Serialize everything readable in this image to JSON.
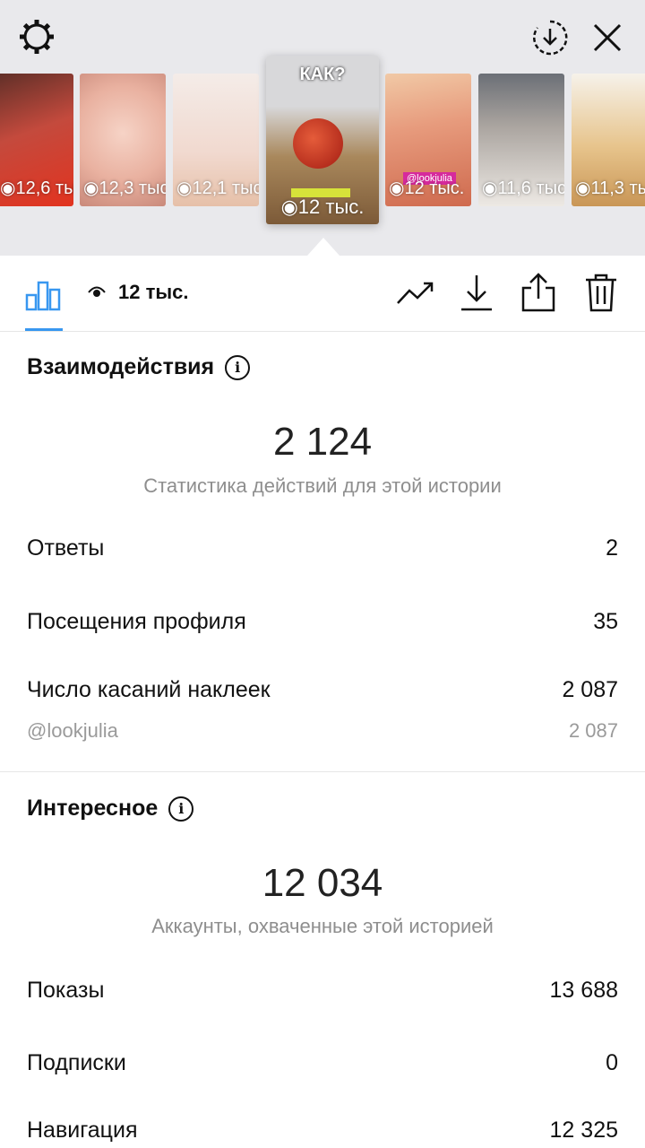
{
  "top": {
    "thumbnails": [
      {
        "views": "12,6 тыс."
      },
      {
        "views": "12,3 тыс."
      },
      {
        "views": "12,1 тыс."
      },
      {
        "views": "12 тыс.",
        "heading": "КАК?",
        "sticker": "@lookjulia"
      },
      {
        "views": "12 тыс.",
        "sticker": "@lookjulia"
      },
      {
        "views": "11,6 тыс."
      },
      {
        "views": "11,3 тыс."
      }
    ],
    "icons": [
      "gear-icon",
      "download-circle-icon",
      "close-icon"
    ]
  },
  "toolbar": {
    "views": "12 тыс.",
    "icons": [
      "bar-chart-icon",
      "eye-icon",
      "trend-icon",
      "download-icon",
      "share-icon",
      "trash-icon"
    ],
    "accent": "#3897f0"
  },
  "interactions": {
    "title": "Взаимодействия",
    "total": "2 124",
    "caption": "Статистика действий для этой истории",
    "rows": [
      {
        "label": "Ответы",
        "value": "2"
      },
      {
        "label": "Посещения профиля",
        "value": "35"
      },
      {
        "label": "Число касаний наклеек",
        "value": "2 087"
      }
    ],
    "sub_row": {
      "label": "@lookjulia",
      "value": "2 087"
    }
  },
  "discovery": {
    "title": "Интересное",
    "total": "12 034",
    "caption": "Аккаунты, охваченные этой историей",
    "rows": [
      {
        "label": "Показы",
        "value": "13 688"
      },
      {
        "label": "Подписки",
        "value": "0"
      },
      {
        "label": "Навигация",
        "value": "12 325"
      }
    ]
  }
}
